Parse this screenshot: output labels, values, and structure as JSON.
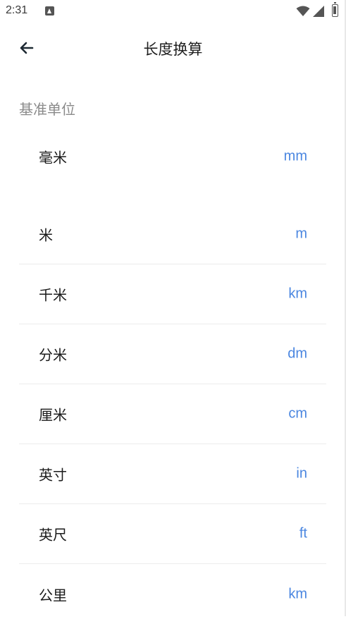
{
  "status_bar": {
    "time": "2:31"
  },
  "app_bar": {
    "title": "长度换算",
    "back_icon": "arrow-left-icon"
  },
  "base_section": {
    "label": "基准单位",
    "name": "毫米",
    "unit": "mm"
  },
  "units": [
    {
      "name": "米",
      "unit": "m"
    },
    {
      "name": "千米",
      "unit": "km"
    },
    {
      "name": "分米",
      "unit": "dm"
    },
    {
      "name": "厘米",
      "unit": "cm"
    },
    {
      "name": "英寸",
      "unit": "in"
    },
    {
      "name": "英尺",
      "unit": "ft"
    },
    {
      "name": "公里",
      "unit": "km"
    }
  ],
  "colors": {
    "unit_accent": "#4a86e0",
    "section_label": "#8a8a8a",
    "divider": "#ececec"
  }
}
